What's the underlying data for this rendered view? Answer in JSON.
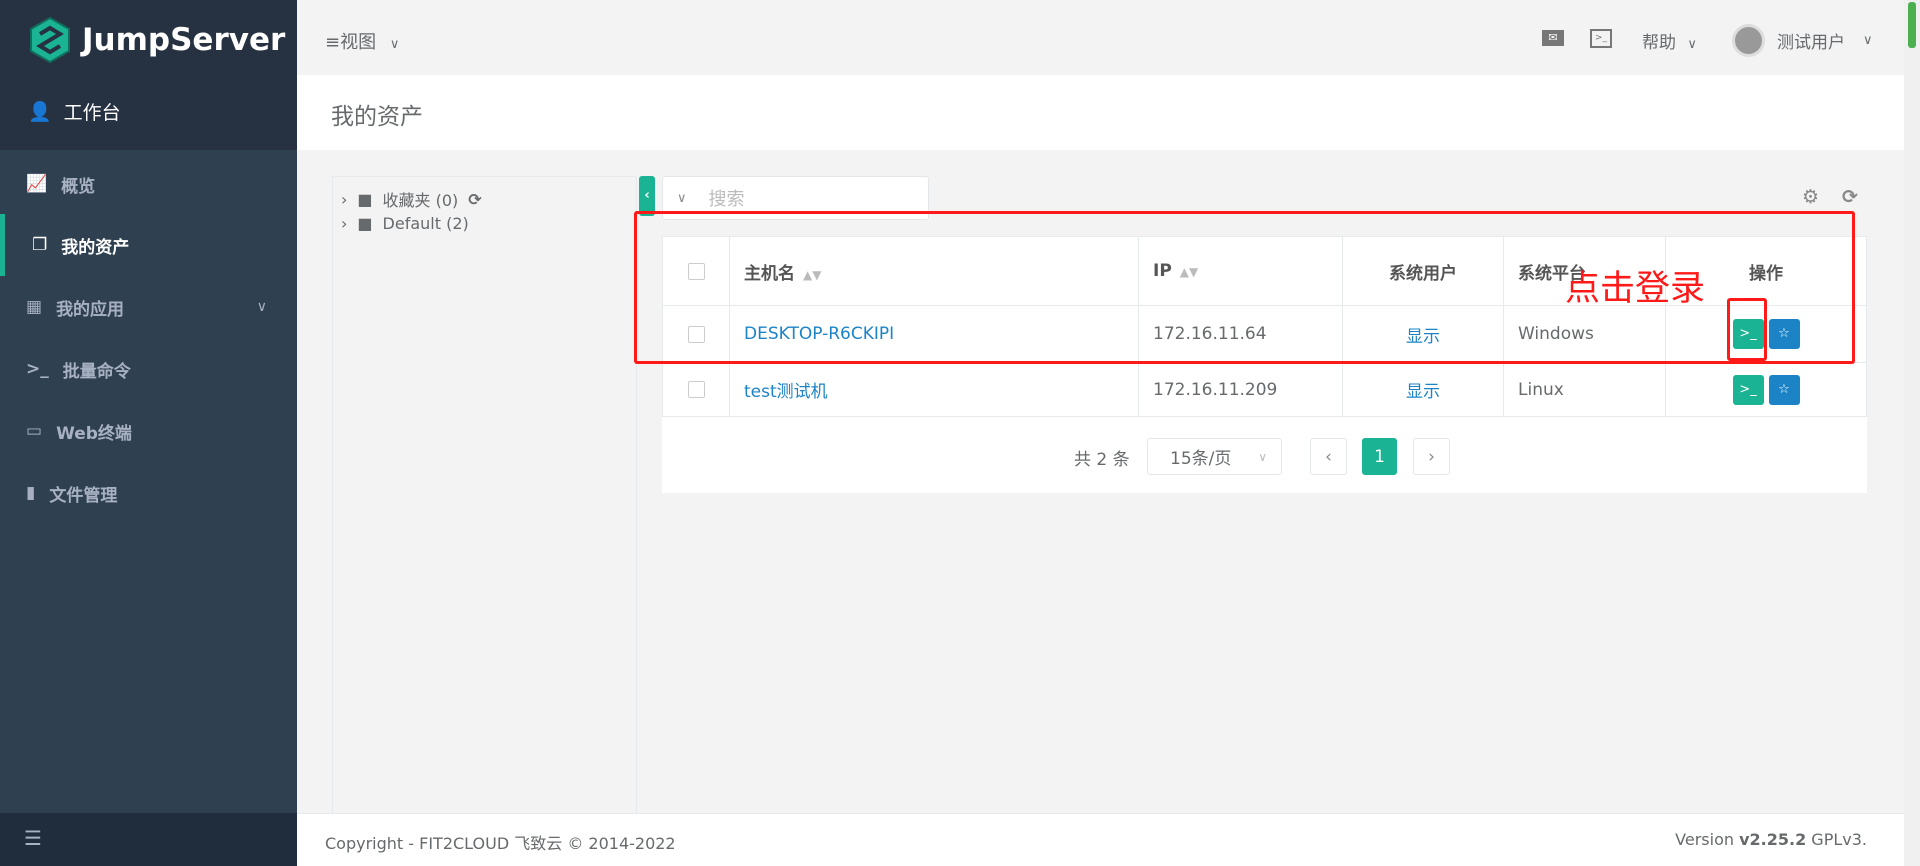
{
  "sidebar": {
    "brand": "JumpServer",
    "workspace": "工作台",
    "items": [
      {
        "label": "概览",
        "icon": "area-chart-icon"
      },
      {
        "label": "我的资产",
        "icon": "assets-icon",
        "active": true
      },
      {
        "label": "我的应用",
        "icon": "grid-icon"
      },
      {
        "label": "批量命令",
        "icon": "terminal-icon"
      },
      {
        "label": "Web终端",
        "icon": "window-icon"
      },
      {
        "label": "文件管理",
        "icon": "file-icon"
      }
    ]
  },
  "topbar": {
    "view": "视图",
    "help": "帮助",
    "user": "测试用户"
  },
  "page": {
    "title": "我的资产"
  },
  "tree": {
    "nodes": [
      {
        "label": "收藏夹 (0)"
      },
      {
        "label": "Default (2)"
      }
    ]
  },
  "search": {
    "placeholder": "搜索"
  },
  "table": {
    "headers": [
      "主机名",
      "IP",
      "系统用户",
      "系统平台",
      "操作"
    ],
    "rows": [
      {
        "hostname": "DESKTOP-R6CKIPI",
        "ip": "172.16.11.64",
        "sysuser": "显示",
        "platform": "Windows"
      },
      {
        "hostname": "test测试机",
        "ip": "172.16.11.209",
        "sysuser": "显示",
        "platform": "Linux"
      }
    ]
  },
  "pagination": {
    "total": "共 2 条",
    "page_size": "15条/页",
    "current": "1"
  },
  "footer": {
    "copyright": "Copyright - FIT2CLOUD 飞致云 © 2014-2022",
    "version_prefix": "Version ",
    "version": "v2.25.2",
    "license": " GPLv3."
  },
  "annotation": {
    "text": "点击登录",
    "color": "#ff1a1a"
  },
  "colors": {
    "accent": "#1ab394",
    "link": "#1c84c6",
    "sidebar": "#2f4050"
  }
}
